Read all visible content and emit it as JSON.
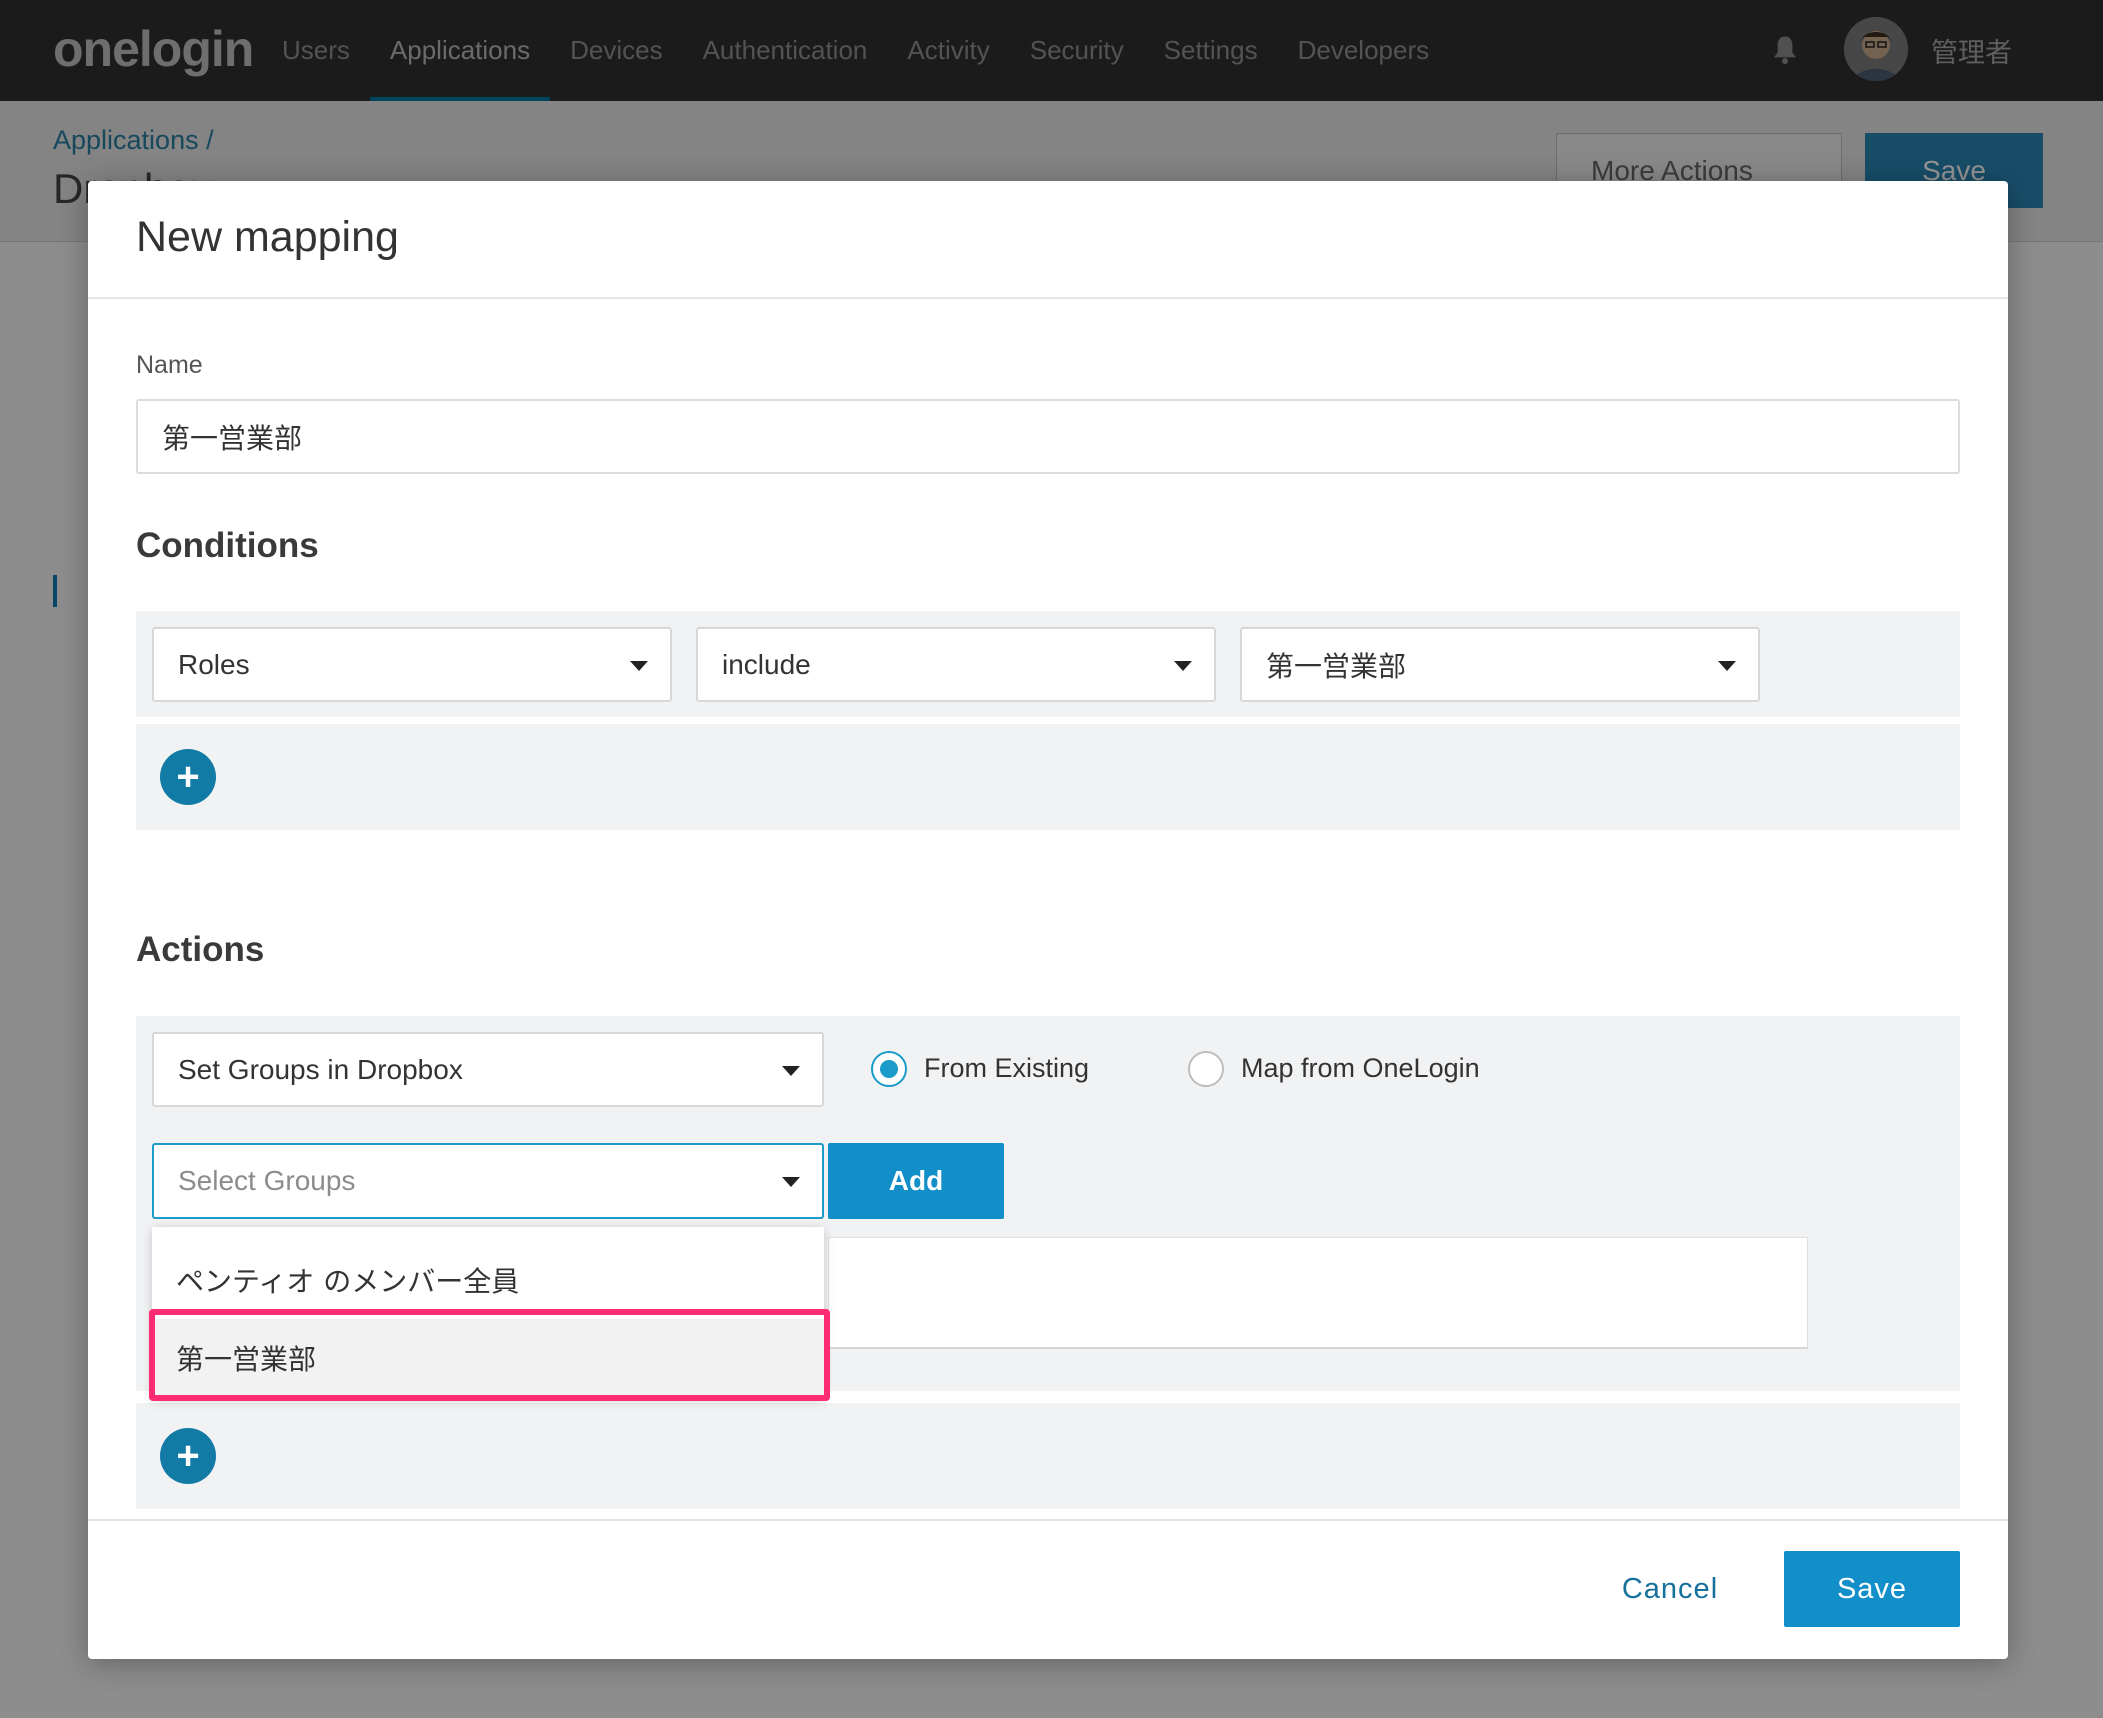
{
  "app": {
    "logo": "onelogin",
    "username": "管理者"
  },
  "nav": {
    "items": [
      {
        "label": "Users"
      },
      {
        "label": "Applications",
        "active": true
      },
      {
        "label": "Devices"
      },
      {
        "label": "Authentication"
      },
      {
        "label": "Activity"
      },
      {
        "label": "Security"
      },
      {
        "label": "Settings"
      },
      {
        "label": "Developers"
      }
    ],
    "bell_icon": "bell-icon",
    "active_color": "#00779f"
  },
  "page": {
    "breadcrumb": "Applications /",
    "title": "Dropbox",
    "more_actions_label": "More Actions",
    "save_label": "Save"
  },
  "modal": {
    "title": "New mapping",
    "name_label": "Name",
    "name_value": "第一営業部",
    "conditions": {
      "heading": "Conditions",
      "rows": [
        {
          "field": "Roles",
          "operator": "include",
          "value": "第一営業部"
        }
      ]
    },
    "actions": {
      "heading": "Actions",
      "action_select": "Set Groups in Dropbox",
      "radio_options": [
        {
          "label": "From Existing",
          "checked": true
        },
        {
          "label": "Map from OneLogin",
          "checked": false
        }
      ],
      "groups_select": {
        "placeholder": "Select Groups"
      },
      "add_label": "Add",
      "dropdown_options": [
        {
          "label": "ペンティオ のメンバー全員",
          "highlighted": false
        },
        {
          "label": "第一営業部",
          "highlighted": true
        }
      ]
    },
    "cancel_label": "Cancel",
    "save_label": "Save"
  },
  "colors": {
    "primary_button": "#128fc9",
    "highlight_frame": "#ff2c73",
    "link": "#16709c"
  }
}
